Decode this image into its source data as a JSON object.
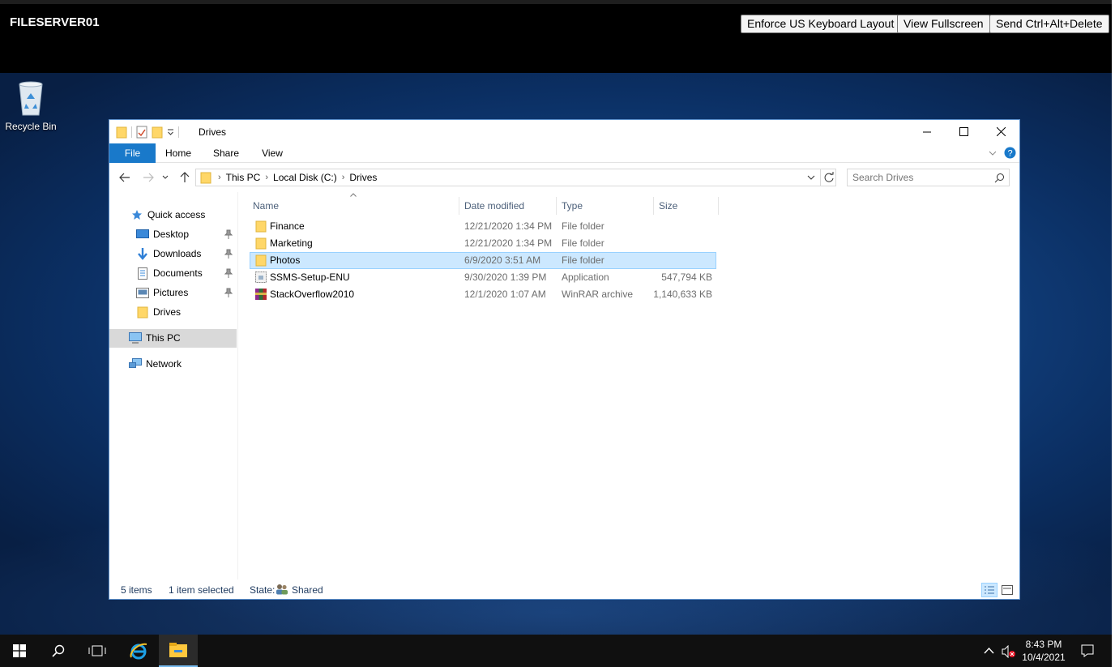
{
  "rdp": {
    "title": "FILESERVER01",
    "buttons": [
      "Enforce US Keyboard Layout",
      "View Fullscreen",
      "Send Ctrl+Alt+Delete"
    ]
  },
  "desktop": {
    "icons": [
      {
        "label": "Recycle Bin",
        "icon": "recycle-bin-icon"
      }
    ]
  },
  "explorer": {
    "title": "Drives",
    "ribbon_tabs": [
      "File",
      "Home",
      "Share",
      "View"
    ],
    "address": [
      "This PC",
      "Local Disk (C:)",
      "Drives"
    ],
    "search_placeholder": "Search Drives",
    "nav": {
      "quick_access": "Quick access",
      "pinned": [
        "Desktop",
        "Downloads",
        "Documents",
        "Pictures"
      ],
      "recent": "Drives",
      "this_pc": "This PC",
      "network": "Network"
    },
    "columns": [
      "Name",
      "Date modified",
      "Type",
      "Size"
    ],
    "files": [
      {
        "name": "Finance",
        "date": "12/21/2020 1:34 PM",
        "type": "File folder",
        "size": "",
        "icon": "folder-icon"
      },
      {
        "name": "Marketing",
        "date": "12/21/2020 1:34 PM",
        "type": "File folder",
        "size": "",
        "icon": "folder-icon"
      },
      {
        "name": "Photos",
        "date": "6/9/2020 3:51 AM",
        "type": "File folder",
        "size": "",
        "icon": "folder-icon",
        "selected": true
      },
      {
        "name": "SSMS-Setup-ENU",
        "date": "9/30/2020 1:39 PM",
        "type": "Application",
        "size": "547,794 KB",
        "icon": "installer-icon"
      },
      {
        "name": "StackOverflow2010",
        "date": "12/1/2020 1:07 AM",
        "type": "WinRAR archive",
        "size": "1,140,633 KB",
        "icon": "winrar-icon"
      }
    ],
    "status": {
      "items": "5 items",
      "selected": "1 item selected",
      "state_label": "State:",
      "state_value": "Shared"
    }
  },
  "taskbar": {
    "time": "8:43 PM",
    "date": "10/4/2021"
  },
  "colors": {
    "accent": "#1979ca",
    "selection": "#cce8ff",
    "folder": "#ffd768"
  }
}
